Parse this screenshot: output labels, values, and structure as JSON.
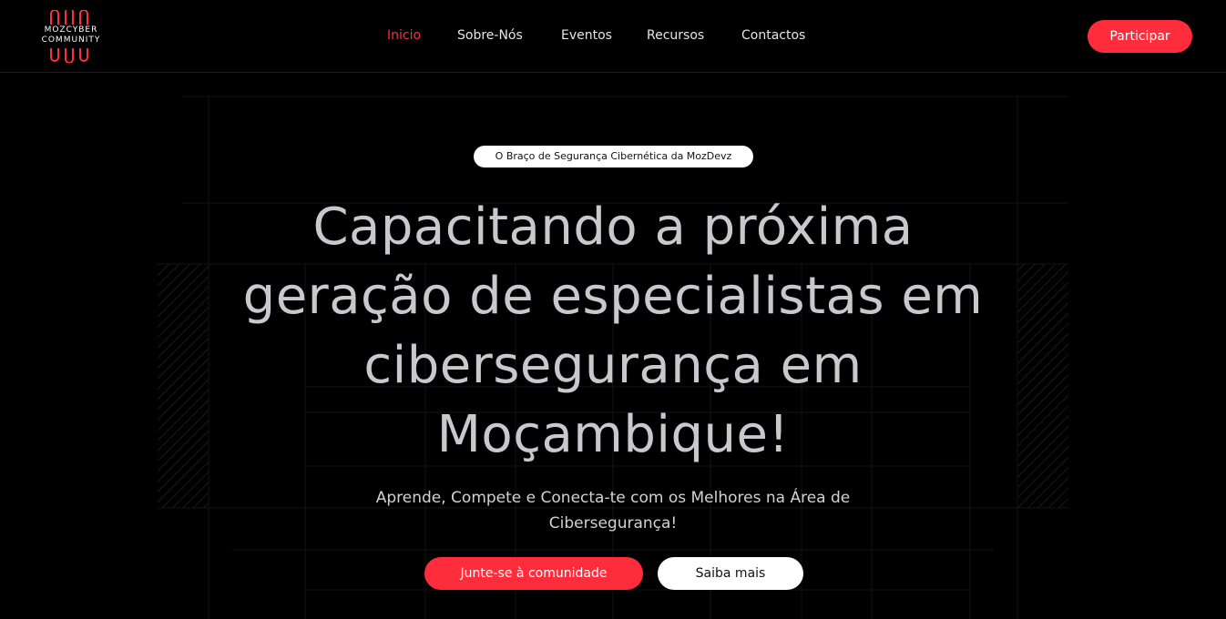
{
  "brand": {
    "logo_line1": "MOZCYBER",
    "logo_line2": "COMMUNITY",
    "logo_icon": "mozcyber-logo-icon"
  },
  "nav": {
    "items": [
      {
        "label": "Inicio",
        "active": true
      },
      {
        "label": "Sobre-Nós",
        "active": false
      },
      {
        "label": "Eventos",
        "active": false
      },
      {
        "label": "Recursos",
        "active": false
      },
      {
        "label": "Contactos",
        "active": false
      }
    ],
    "cta_label": "Participar"
  },
  "hero": {
    "badge": "O Braço de Segurança Cibernética da MozDevz",
    "title_lines": [
      "Capacitando a próxima",
      "geração de especialistas em",
      "cibersegurança em",
      "Moçambique!"
    ],
    "subtitle_lines": [
      "Aprende, Compete e Conecta-te com os Melhores na Área de",
      "Cibersegurança!"
    ],
    "primary_button": "Junte-se à comunidade",
    "secondary_button": "Saiba mais"
  },
  "colors": {
    "accent": "#ff2d3c",
    "background": "#000000",
    "title_text": "#c8c8ce",
    "nav_text": "#e6e6e6"
  }
}
